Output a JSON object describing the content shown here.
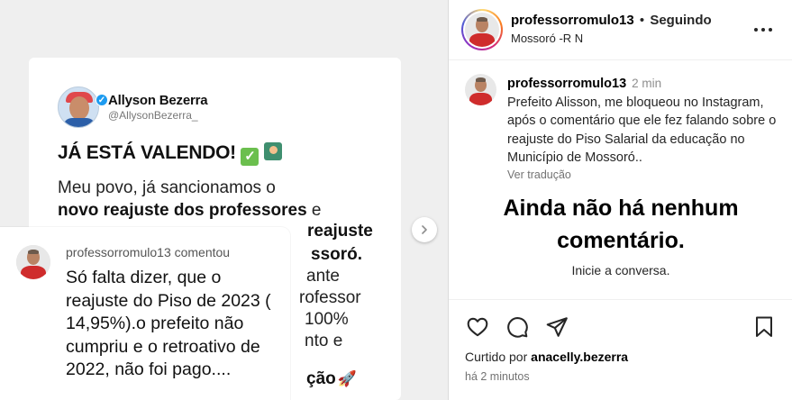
{
  "tweet": {
    "author_name": "Allyson Bezerra",
    "author_handle": "@AllysonBezerra_",
    "headline": "JÁ ESTÁ VALENDO!",
    "body_line1": "Meu povo, já sancionamos o",
    "body_bold1": "novo reajuste dos professores",
    "body_tail1": " e",
    "body_partial": "reajuste",
    "body_partial2": "ssoró.",
    "body_frag_a": "ante",
    "body_frag_b": "rofessor",
    "body_frag_c": "100%",
    "body_frag_d": "nto e",
    "bottom_text": "ção"
  },
  "overlay": {
    "meta": "professorromulo13 comentou",
    "comment": "Só falta dizer, que o reajuste do Piso de 2023 ( 14,95%).o prefeito não cumpriu e o retroativo de 2022, não foi pago...."
  },
  "header": {
    "username": "professorromulo13",
    "separator": "•",
    "follow_status": "Seguindo",
    "location": "Mossoró -R N"
  },
  "caption": {
    "username": "professorromulo13",
    "time": "2 min",
    "text": "Prefeito Alisson, me bloqueou no Instagram, após o comentário que ele fez falando sobre o reajuste do Piso Salarial da educação no Município de Mossoró..",
    "translate": "Ver tradução"
  },
  "empty": {
    "title": "Ainda não há nenhum comentário.",
    "subtitle": "Inicie a conversa."
  },
  "likes": {
    "prefix": "Curtido por ",
    "user": "anacelly.bezerra"
  },
  "posted": "há 2 minutos",
  "icons": {
    "like": "heart-icon",
    "comment": "comment-icon",
    "share": "share-icon",
    "save": "bookmark-icon",
    "more": "more-icon",
    "next": "chevron-right-icon"
  }
}
